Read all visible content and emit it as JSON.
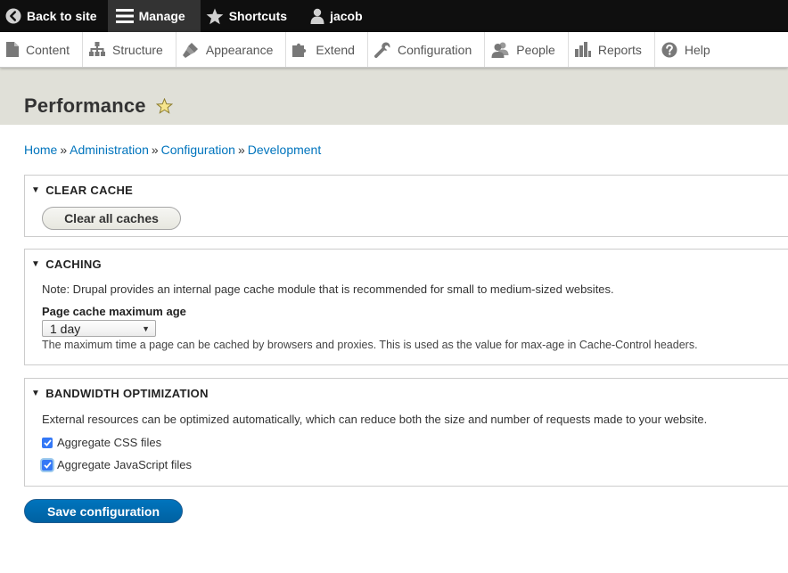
{
  "toolbar": {
    "back_label": "Back to site",
    "manage_label": "Manage",
    "shortcuts_label": "Shortcuts",
    "user_label": "jacob"
  },
  "tray": {
    "items": [
      {
        "label": "Content",
        "icon": "file-icon"
      },
      {
        "label": "Structure",
        "icon": "sitemap-icon"
      },
      {
        "label": "Appearance",
        "icon": "paintbrush-icon"
      },
      {
        "label": "Extend",
        "icon": "puzzle-icon"
      },
      {
        "label": "Configuration",
        "icon": "wrench-icon"
      },
      {
        "label": "People",
        "icon": "people-icon"
      },
      {
        "label": "Reports",
        "icon": "bar-chart-icon"
      },
      {
        "label": "Help",
        "icon": "help-icon"
      }
    ]
  },
  "page": {
    "title": "Performance"
  },
  "breadcrumb": [
    "Home",
    "Administration",
    "Configuration",
    "Development"
  ],
  "clear_cache": {
    "title": "Clear cache",
    "button": "Clear all caches"
  },
  "caching": {
    "title": "Caching",
    "note": "Note: Drupal provides an internal page cache module that is recommended for small to medium-sized websites.",
    "label": "Page cache maximum age",
    "value": "1 day",
    "description": "The maximum time a page can be cached by browsers and proxies. This is used as the value for max-age in Cache-Control headers."
  },
  "bandwidth": {
    "title": "Bandwidth optimization",
    "description": "External resources can be optimized automatically, which can reduce both the size and number of requests made to your website.",
    "css_label": "Aggregate CSS files",
    "css_checked": true,
    "js_label": "Aggregate JavaScript files",
    "js_checked": true
  },
  "actions": {
    "save": "Save configuration"
  },
  "colors": {
    "link": "#0074bd",
    "primary_button": "#0074bd",
    "toolbar_bg": "#0f0f0f",
    "header_bg": "#e0e0d8",
    "checkbox": "#3478f6",
    "star": "#f0d84a"
  }
}
